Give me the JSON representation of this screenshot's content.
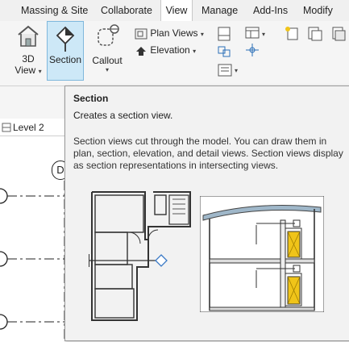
{
  "menu": {
    "tabs": [
      {
        "label": "Massing & Site"
      },
      {
        "label": "Collaborate"
      },
      {
        "label": "View"
      },
      {
        "label": "Manage"
      },
      {
        "label": "Add-Ins"
      },
      {
        "label": "Modify"
      }
    ]
  },
  "ribbon": {
    "view3d_label": "3D",
    "view3d_sub": "View",
    "section_label": "Section",
    "callout_label": "Callout",
    "plan_views_label": "Plan Views",
    "elevation_label": "Elevation"
  },
  "view_tab": {
    "label": "Level 2"
  },
  "grid_bubble": {
    "label": "D"
  },
  "tooltip": {
    "title": "Section",
    "summary": "Creates a section view.",
    "description": "Section views cut through the model. You can draw them in plan, section, elevation, and detail views. Section views display as section representations in intersecting views."
  },
  "colors": {
    "accent_selected": "#cde8f7",
    "tooltip_bg": "#f2f2f2",
    "door_fill": "#f0c419",
    "roof_fill": "#9fb7c9"
  },
  "icons": [
    "house-3d-icon",
    "section-icon",
    "callout-icon",
    "plan-views-icon",
    "elevation-icon"
  ]
}
